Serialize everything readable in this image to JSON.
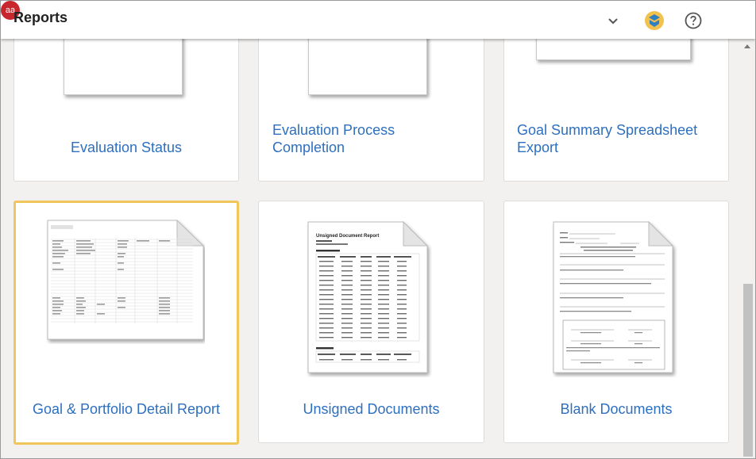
{
  "app": {
    "title": "Reports"
  },
  "header": {
    "avatar_initials": "aa",
    "icons": [
      "chevron-down-icon",
      "app-logo-icon",
      "help-icon"
    ]
  },
  "reports": [
    {
      "label": "Evaluation Status"
    },
    {
      "label": "Evaluation Process Completion"
    },
    {
      "label": "Goal Summary Spreadsheet Export"
    },
    {
      "label": "Goal & Portfolio Detail Report"
    },
    {
      "label": "Unsigned Documents"
    },
    {
      "label": "Blank Documents"
    }
  ],
  "thumbnails": {
    "unsigned_title": "Unsigned Document Report"
  },
  "colors": {
    "link": "#2d6fc0",
    "selected_border": "#f0c65a",
    "avatar_bg": "#c8282d"
  }
}
